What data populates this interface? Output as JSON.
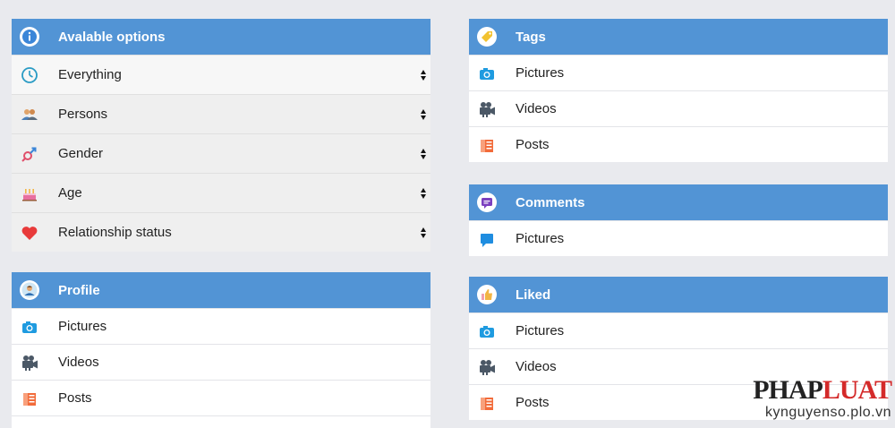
{
  "available_options": {
    "title": "Avalable options",
    "icon": "info-icon",
    "items": [
      {
        "label": "Everything",
        "icon": "clock-icon"
      },
      {
        "label": "Persons",
        "icon": "persons-icon"
      },
      {
        "label": "Gender",
        "icon": "gender-icon"
      },
      {
        "label": "Age",
        "icon": "cake-icon"
      },
      {
        "label": "Relationship status",
        "icon": "heart-icon"
      }
    ]
  },
  "profile": {
    "title": "Profile",
    "icon": "user-icon",
    "items": [
      {
        "label": "Pictures",
        "icon": "camera-icon"
      },
      {
        "label": "Videos",
        "icon": "video-camera-icon"
      },
      {
        "label": "Posts",
        "icon": "posts-icon"
      }
    ]
  },
  "tags": {
    "title": "Tags",
    "icon": "tag-icon",
    "items": [
      {
        "label": "Pictures",
        "icon": "camera-icon"
      },
      {
        "label": "Videos",
        "icon": "video-camera-icon"
      },
      {
        "label": "Posts",
        "icon": "posts-icon"
      }
    ]
  },
  "comments": {
    "title": "Comments",
    "icon": "comment-icon",
    "items": [
      {
        "label": "Pictures",
        "icon": "speech-bubble-icon"
      }
    ]
  },
  "liked": {
    "title": "Liked",
    "icon": "thumbs-up-icon",
    "items": [
      {
        "label": "Pictures",
        "icon": "camera-icon"
      },
      {
        "label": "Videos",
        "icon": "video-camera-icon"
      },
      {
        "label": "Posts",
        "icon": "posts-icon"
      }
    ]
  },
  "watermark": {
    "logo_part1": "PHAP",
    "logo_part2": "LUAT",
    "url": "kynguyenso.plo.vn"
  },
  "colors": {
    "header": "#5294d5",
    "background": "#e9eaee"
  }
}
